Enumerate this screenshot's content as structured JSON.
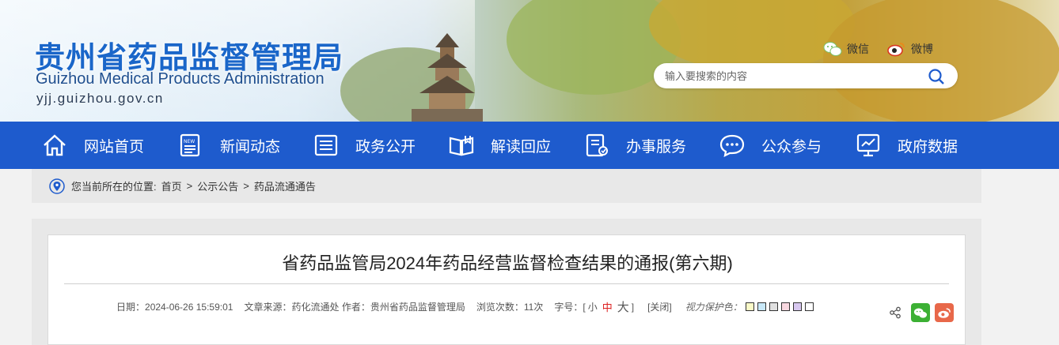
{
  "header": {
    "title_cn": "贵州省药品监督管理局",
    "title_en": "Guizhou Medical Products Administration",
    "url": "yjj.guizhou.gov.cn",
    "wechat_label": "微信",
    "weibo_label": "微博",
    "search_placeholder": "输入要搜索的内容"
  },
  "nav": {
    "items": [
      {
        "label": "网站首页",
        "icon": "home-icon"
      },
      {
        "label": "新闻动态",
        "icon": "news-icon"
      },
      {
        "label": "政务公开",
        "icon": "document-list-icon"
      },
      {
        "label": "解读回应",
        "icon": "open-book-icon"
      },
      {
        "label": "办事服务",
        "icon": "service-form-icon"
      },
      {
        "label": "公众参与",
        "icon": "chat-bubble-icon"
      },
      {
        "label": "政府数据",
        "icon": "data-screen-icon"
      }
    ]
  },
  "breadcrumb": {
    "prefix": "您当前所在的位置:",
    "items": [
      "首页",
      "公示公告",
      "药品流通通告"
    ],
    "separator": ">"
  },
  "article": {
    "title": "省药品监管局2024年药品经营监督检查结果的通报(第六期)",
    "date_label": "日期：",
    "date": "2024-06-26 15:59:01",
    "source_label": "文章来源：",
    "source": "药化流通处",
    "author_label": "作者：",
    "author": "贵州省药品监督管理局",
    "views_label": "浏览次数：",
    "views": "11次",
    "font_label": "字号：[",
    "font_small": "小",
    "font_medium": "中",
    "font_large": "大",
    "font_close": "]",
    "close_label": "[关闭]",
    "eye_label": "视力保护色：",
    "eye_colors": [
      "#fafac8",
      "#c8e8f8",
      "#e0e0e0",
      "#f8d8e0",
      "#d8c8f0",
      "#ffffff"
    ],
    "share_wechat_color": "#3cb034",
    "share_weibo_color": "#e8684a"
  }
}
